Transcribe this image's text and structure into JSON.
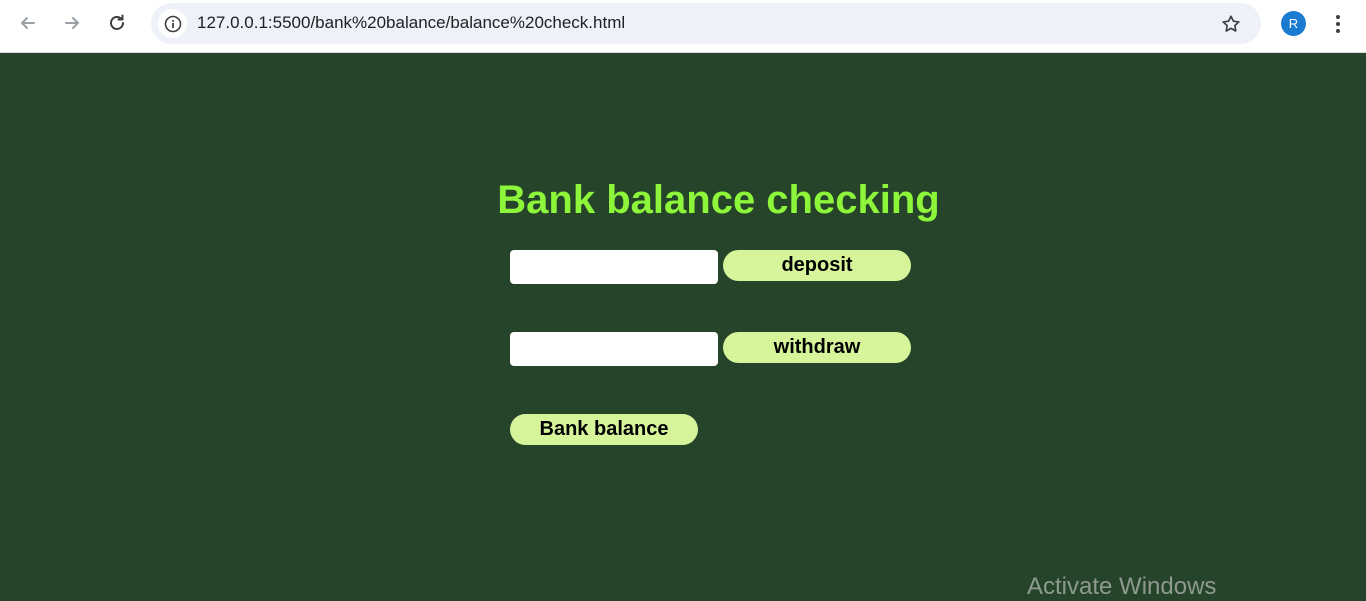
{
  "browser": {
    "url": "127.0.0.1:5500/bank%20balance/balance%20check.html",
    "profile_initial": "R"
  },
  "page": {
    "title": "Bank balance checking",
    "deposit_button": "deposit",
    "withdraw_button": "withdraw",
    "balance_button": "Bank balance",
    "deposit_value": "",
    "withdraw_value": ""
  },
  "os": {
    "watermark": "Activate Windows"
  },
  "colors": {
    "background": "#25442a",
    "title": "#8df53a",
    "button": "#d6f59a"
  }
}
